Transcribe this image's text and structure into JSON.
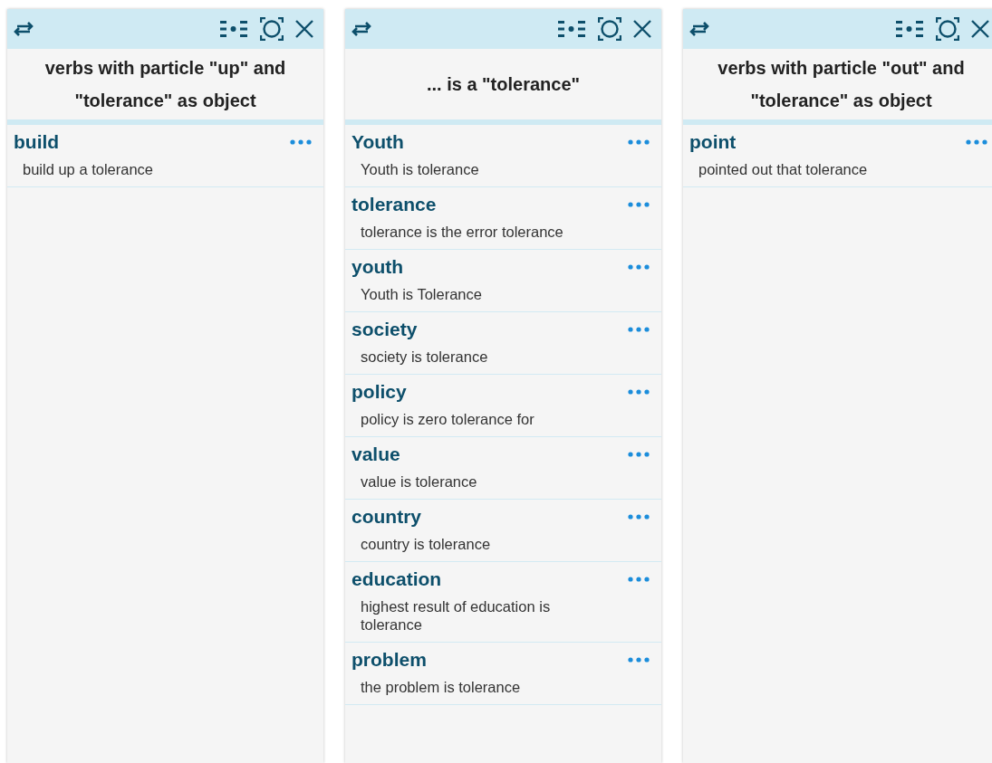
{
  "panels": [
    {
      "title": "verbs with particle \"up\" and \"tolerance\" as object",
      "entries": [
        {
          "word": "build",
          "example": "build up a tolerance"
        }
      ]
    },
    {
      "title": "... is a \"tolerance\"",
      "entries": [
        {
          "word": "Youth",
          "example": "Youth is tolerance"
        },
        {
          "word": "tolerance",
          "example": "tolerance is the error tolerance"
        },
        {
          "word": "youth",
          "example": "Youth is Tolerance"
        },
        {
          "word": "society",
          "example": "society is tolerance"
        },
        {
          "word": "policy",
          "example": "policy is zero tolerance for"
        },
        {
          "word": "value",
          "example": "value is tolerance"
        },
        {
          "word": "country",
          "example": "country is tolerance"
        },
        {
          "word": "education",
          "example": "highest result of education is tolerance"
        },
        {
          "word": "problem",
          "example": "the problem is tolerance"
        }
      ]
    },
    {
      "title": "verbs with particle \"out\" and \"tolerance\" as object",
      "entries": [
        {
          "word": "point",
          "example": "pointed out that tolerance"
        }
      ]
    }
  ]
}
